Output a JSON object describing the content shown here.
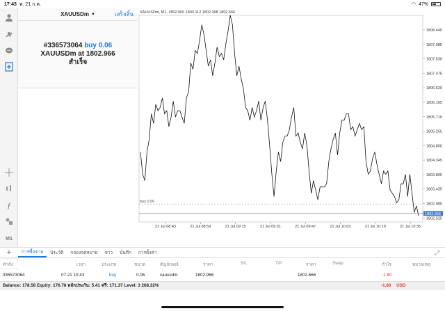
{
  "status_bar": {
    "time": "17:43",
    "date": "พ. 21 ก.ค.",
    "battery": "47%"
  },
  "trade_panel": {
    "symbol": "XAUUSDm",
    "done_label": "เสร็จสิ้น",
    "order_id": "#336573064",
    "order_side": "buy",
    "order_volume": "0.06",
    "line2_prefix": "XAUUSDm at",
    "line2_price": "1802.966",
    "result": "สำเร็จ"
  },
  "chart": {
    "title": "XAUUSDm, M1, 1802.900 1803.112 1802.368 1802.666",
    "buy_line_label": "buy 0.06",
    "current_price_label": "1802.666"
  },
  "chart_data": {
    "type": "line",
    "y_ticks": [
      "1808.440",
      "1807.985",
      "1807.530",
      "1807.075",
      "1806.620",
      "1806.165",
      "1805.710",
      "1805.255",
      "1804.800",
      "1804.345",
      "1803.890",
      "1803.435",
      "1802.980",
      "1802.525"
    ],
    "x_ticks": [
      "21 Jul 08:43",
      "21 Jul 08:59",
      "21 Jul 09:15",
      "21 Jul 09:31",
      "21 Jul 09:47",
      "21 Jul 10:03",
      "21 Jul 10:19",
      "21 Jul 10:35"
    ],
    "ylim": [
      1802.4,
      1808.9
    ],
    "buy_level": 1802.966,
    "last_price": 1802.666,
    "values": [
      1804.6,
      1803.9,
      1803.7,
      1804.6,
      1805.0,
      1805.8,
      1805.5,
      1806.1,
      1805.9,
      1806.0,
      1806.3,
      1805.8,
      1805.9,
      1805.4,
      1805.7,
      1806.2,
      1805.7,
      1805.9,
      1805.9,
      1805.7,
      1805.5,
      1806.3,
      1806.5,
      1807.4,
      1807.2,
      1807.8,
      1807.7,
      1808.1,
      1808.6,
      1808.3,
      1807.8,
      1807.3,
      1807.5,
      1807.0,
      1807.4,
      1807.9,
      1807.6,
      1807.7,
      1807.5,
      1808.0,
      1808.4,
      1808.9,
      1808.6,
      1807.7,
      1807.0,
      1807.3,
      1806.9,
      1806.6,
      1806.0,
      1805.9,
      1805.6,
      1806.0,
      1805.7,
      1805.9,
      1806.2,
      1805.6,
      1806.0,
      1806.2,
      1805.6,
      1804.8,
      1803.9,
      1803.2,
      1804.0,
      1804.6,
      1804.3,
      1804.9,
      1805.1,
      1805.1,
      1805.3,
      1805.7,
      1806.0,
      1805.1,
      1805.2,
      1804.9,
      1804.7,
      1805.2,
      1804.8,
      1804.0,
      1803.3,
      1803.7,
      1803.4,
      1803.1,
      1803.5,
      1803.5,
      1803.5,
      1803.6,
      1804.3,
      1804.7,
      1805.0,
      1805.2,
      1804.5,
      1805.2,
      1805.6,
      1805.6,
      1805.8,
      1805.8,
      1805.3,
      1805.4,
      1805.1,
      1805.3,
      1805.5,
      1805.3,
      1805.4,
      1804.3,
      1803.9,
      1804.0,
      1804.4,
      1804.6,
      1804.2,
      1803.9,
      1803.6,
      1804.0,
      1803.9,
      1804.0,
      1803.4,
      1803.3,
      1803.2,
      1803.0,
      1803.1,
      1803.6,
      1803.6,
      1803.9,
      1803.2,
      1803.9,
      1803.3,
      1802.7,
      1802.9,
      1802.6
    ]
  },
  "tabs": [
    "การซื้อขาย",
    "ประวัติ",
    "กล่องจดหมาย",
    "ข่าว",
    "บันทึก",
    "การตั้งค่า"
  ],
  "table": {
    "headers": {
      "order": "คำสั่ง",
      "time": "เวลา",
      "type": "ประเภท",
      "volume": "ขนาด",
      "symbol": "สัญลักษณ์",
      "price": "ราคา",
      "sl": "S/L",
      "tp": "T/P",
      "cur_price": "ราคา",
      "swap": "Swap",
      "profit": "กำไร",
      "comment": "หมายเหตุ"
    },
    "row": {
      "order": "336573064",
      "time": "07.21 10:43",
      "type": "buy",
      "volume": "0.06",
      "symbol": "xauusdm",
      "price": "1802.966",
      "cur_price": "1802.666",
      "profit": "-1.80"
    }
  },
  "balance": {
    "text": "Balance: 178.58 Equity: 176.78 หลักประกัน: 5.41 ฟรี: 171.37 Level: 3 268.32%",
    "total": "-1.80",
    "currency": "USD"
  },
  "colors": {
    "accent": "#1a7bd6",
    "negative": "#e0352b"
  }
}
